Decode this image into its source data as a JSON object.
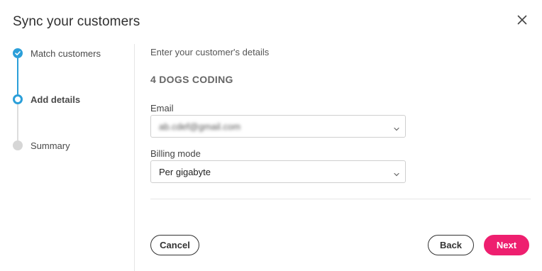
{
  "dialog": {
    "title": "Sync your customers",
    "close_icon": "close-icon"
  },
  "steps": [
    {
      "label": "Match customers",
      "state": "done",
      "icon": "check-circle-icon"
    },
    {
      "label": "Add details",
      "state": "active",
      "icon": "current-step-icon"
    },
    {
      "label": "Summary",
      "state": "pending",
      "icon": "pending-step-icon"
    }
  ],
  "form": {
    "subtitle": "Enter your customer's details",
    "company_name": "4 DOGS CODING",
    "email": {
      "label": "Email",
      "value": "ab.cdef@gmail.com",
      "obscured": true,
      "icon": "chevron-down-icon"
    },
    "billing_mode": {
      "label": "Billing mode",
      "value": "Per gigabyte",
      "icon": "chevron-down-icon"
    }
  },
  "actions": {
    "cancel_label": "Cancel",
    "back_label": "Back",
    "next_label": "Next"
  },
  "colors": {
    "accent": "#2b9fd9",
    "primary_button": "#ee1f6f",
    "pending": "#d6d6d6"
  }
}
